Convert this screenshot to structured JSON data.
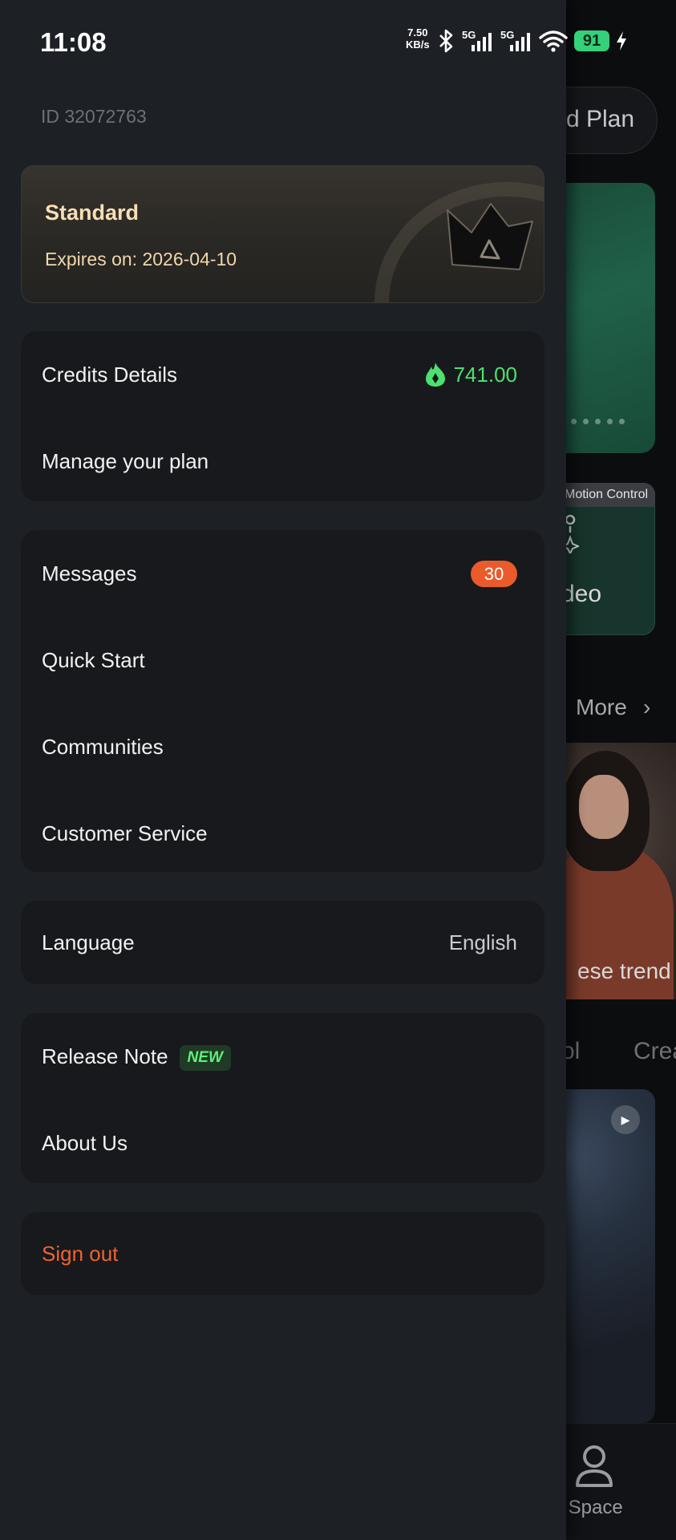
{
  "status_bar": {
    "time": "11:08",
    "net_speed_value": "7.50",
    "net_speed_unit": "KB/s",
    "signal_1_label": "5G",
    "signal_2_label": "5G",
    "battery": "91"
  },
  "background": {
    "plan_button_text": "rd Plan",
    "card_tag": "Motion Control",
    "card_text": "deo",
    "more_label": "More",
    "more_chevron": "›",
    "photo_caption": "ese trend",
    "tab_1": "rol",
    "tab_2": "Crea",
    "play_glyph": "▶",
    "nav_my_space": "y Space"
  },
  "drawer": {
    "user_id": "ID 32072763",
    "membership": {
      "level": "Standard",
      "expiry": "Expires on: 2026-04-10"
    },
    "credits_group": {
      "credits_label": "Credits Details",
      "credits_value": "741.00",
      "manage_plan_label": "Manage your plan"
    },
    "support_group": {
      "messages_label": "Messages",
      "messages_count": "30",
      "quick_start_label": "Quick Start",
      "communities_label": "Communities",
      "customer_service_label": "Customer Service"
    },
    "language_group": {
      "language_label": "Language",
      "language_value": "English"
    },
    "info_group": {
      "release_note_label": "Release Note",
      "release_note_badge": "NEW",
      "about_label": "About Us"
    },
    "signout_label": "Sign out"
  },
  "colors": {
    "drawer_bg": "#1d2025",
    "group_bg": "#18191c",
    "credits_green": "#4de06f",
    "badge_orange": "#ea5a2a",
    "signout_orange": "#f0622f",
    "membership_gold": "#f7dfb5",
    "battery_green": "#33d17a"
  },
  "icons": [
    "bluetooth-icon",
    "wifi-icon",
    "charging-bolt-icon",
    "crown-icon",
    "credits-flame-icon",
    "user-icon",
    "play-icon",
    "chevron-right-icon",
    "sparkle-icon"
  ]
}
